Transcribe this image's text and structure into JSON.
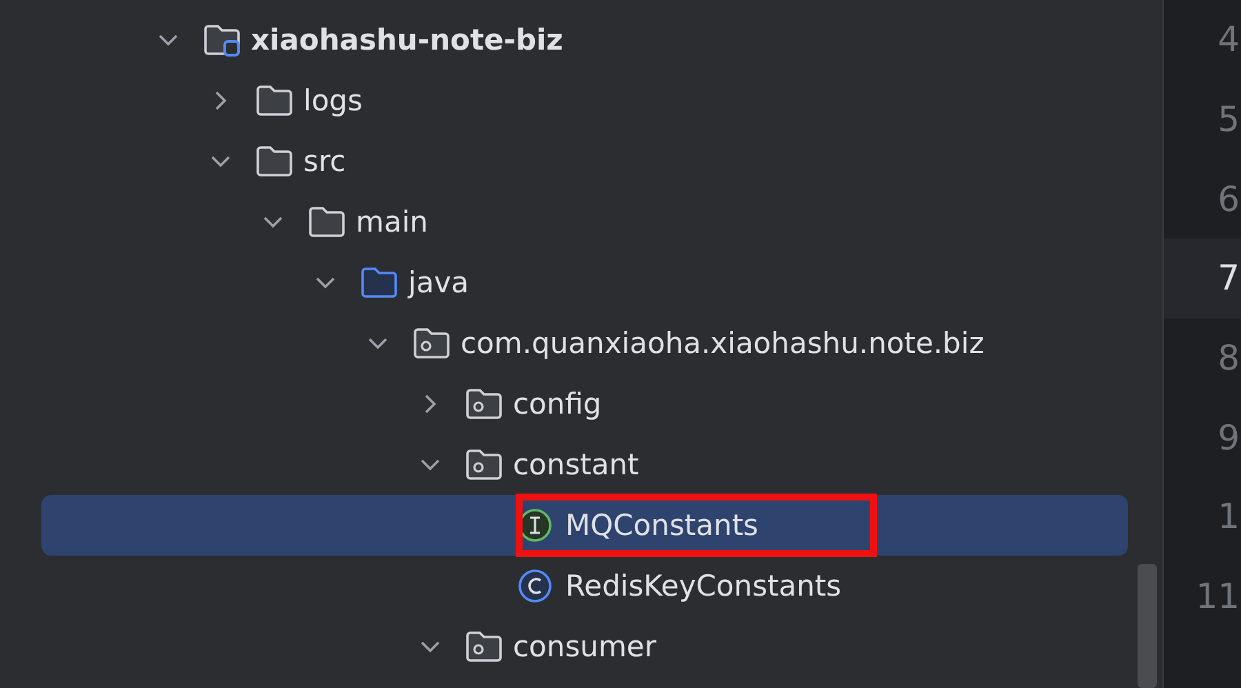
{
  "project_tree": {
    "items": [
      {
        "kind": "module",
        "label": "xiaohashu-note-biz",
        "expanded": true,
        "selected": false,
        "framed": false,
        "children": [
          {
            "kind": "folder",
            "label": "logs",
            "expanded": false,
            "selected": false,
            "framed": false
          },
          {
            "kind": "folder",
            "label": "src",
            "expanded": true,
            "selected": false,
            "framed": false,
            "children": [
              {
                "kind": "folder",
                "label": "main",
                "expanded": true,
                "selected": false,
                "framed": false,
                "children": [
                  {
                    "kind": "source-folder",
                    "label": "java",
                    "expanded": true,
                    "selected": false,
                    "framed": false,
                    "children": [
                      {
                        "kind": "package",
                        "label": "com.quanxiaoha.xiaohashu.note.biz",
                        "expanded": true,
                        "selected": false,
                        "framed": false,
                        "children": [
                          {
                            "kind": "package",
                            "label": "config",
                            "expanded": false,
                            "selected": false,
                            "framed": false
                          },
                          {
                            "kind": "package",
                            "label": "constant",
                            "expanded": true,
                            "selected": false,
                            "framed": false,
                            "children": [
                              {
                                "kind": "interface",
                                "label": "MQConstants",
                                "selected": true,
                                "framed": true
                              },
                              {
                                "kind": "class",
                                "label": "RedisKeyConstants",
                                "selected": false,
                                "framed": false
                              }
                            ]
                          },
                          {
                            "kind": "package",
                            "label": "consumer",
                            "expanded": true,
                            "selected": false,
                            "framed": false
                          }
                        ]
                      }
                    ]
                  }
                ]
              }
            ]
          }
        ]
      }
    ]
  },
  "editor_gutter": {
    "lines": [
      {
        "number": "4",
        "current": false
      },
      {
        "number": "5",
        "current": false
      },
      {
        "number": "6",
        "current": false
      },
      {
        "number": "7",
        "current": true
      },
      {
        "number": "8",
        "current": false
      },
      {
        "number": "9",
        "current": false
      },
      {
        "number": "1",
        "current": false
      },
      {
        "number": "11",
        "current": false
      }
    ]
  }
}
